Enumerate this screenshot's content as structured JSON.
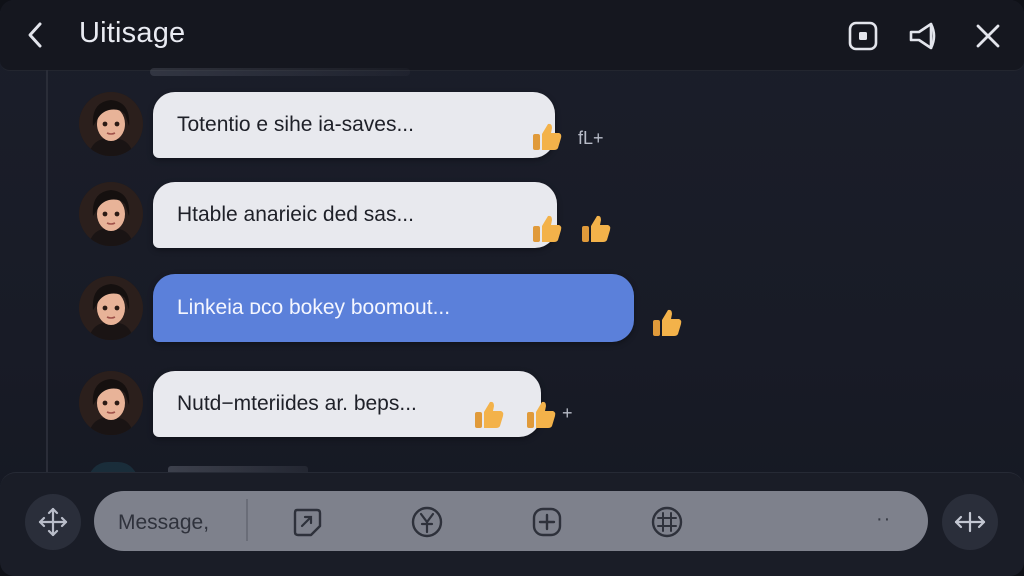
{
  "header": {
    "title": "Uitisage",
    "icons": [
      "back-icon",
      "pip-icon",
      "megaphone-icon",
      "close-icon"
    ]
  },
  "messages": [
    {
      "text": "Totentio e sihe ia-saves...",
      "style": "light",
      "reactions": 1,
      "extra": "fL+"
    },
    {
      "text": "Htable anarieic ded sas...",
      "style": "light",
      "reactions": 2,
      "extra": ""
    },
    {
      "text": "Linkeia ᴅco bokey boomout...",
      "style": "blue",
      "reactions": 1,
      "extra": ""
    },
    {
      "text": "Nutd−mteriides ar. beps...",
      "style": "light",
      "reactions": 2,
      "extra": "+"
    }
  ],
  "composer": {
    "placeholder": "Message,",
    "more": "··",
    "tools": [
      "sticker-icon",
      "currency-icon",
      "add-icon",
      "grid-icon"
    ],
    "left_button": "move-icon",
    "right_button": "resize-horizontal-icon"
  },
  "colors": {
    "accent_blue": "#5b80da",
    "bubble_light": "#e8e9ee",
    "background": "#181b26",
    "thumb": "#f3b24a"
  }
}
